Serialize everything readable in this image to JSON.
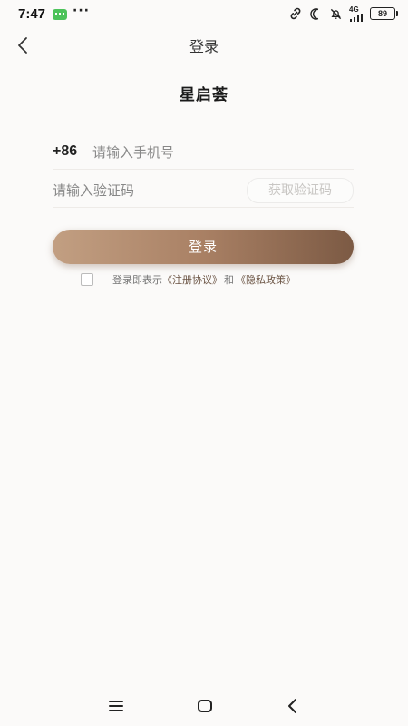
{
  "status_bar": {
    "time": "7:47",
    "network": "4G",
    "battery": "89",
    "icons": [
      "wechat-icon",
      "more-dots-icon",
      "link-icon",
      "moon-icon",
      "bell-off-icon",
      "signal-icon",
      "battery-icon"
    ]
  },
  "header": {
    "title": "登录",
    "back_icon": "chevron-left-icon"
  },
  "brand": "星启荟",
  "form": {
    "phone_prefix": "+86",
    "phone_placeholder": "请输入手机号",
    "phone_value": "",
    "code_placeholder": "请输入验证码",
    "code_value": "",
    "get_code_label": "获取验证码",
    "login_label": "登录"
  },
  "agreement": {
    "checked": false,
    "prefix": "登录即表示",
    "terms_link": "《注册协议》",
    "and": "和",
    "privacy_link": "《隐私政策》"
  },
  "colors": {
    "button_gradient_start": "#c29f82",
    "button_gradient_end": "#7c5a44",
    "link": "#6b5444",
    "background": "#fbfaf9"
  },
  "nav_bar": {
    "icons": [
      "menu-icon",
      "home-square-icon",
      "back-triangle-icon"
    ]
  }
}
